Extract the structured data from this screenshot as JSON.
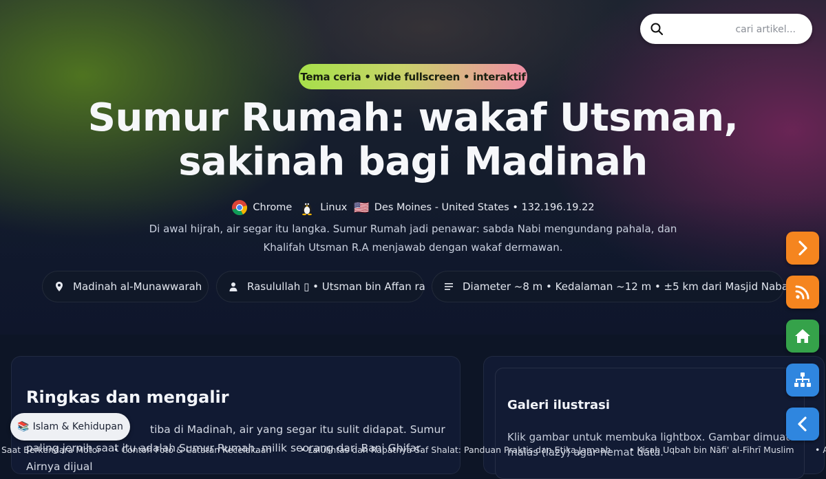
{
  "search": {
    "placeholder": "cari artikel..."
  },
  "hero": {
    "pill": "Tema ceria • wide fullscreen • interaktif",
    "title": "Sumur Rumah: wakaf Utsman, sakinah bagi Madinah",
    "meta": {
      "browser": "Chrome",
      "os": "Linux",
      "location": "Des Moines - United States • 132.196.19.22",
      "flag": "🇺🇸"
    },
    "description": "Di awal hijrah, air segar itu langka. Sumur Rumah jadi penawar: sabda Nabi mengundang pahala, dan Khalifah Utsman R.A menjawab dengan wakaf dermawan.",
    "chips": [
      {
        "icon": "location-pin-icon",
        "label": "Madinah al-Munawwarah"
      },
      {
        "icon": "person-icon",
        "label": "Rasulullah ▯ • Utsman bin Affan ra"
      },
      {
        "icon": "list-icon",
        "label": "Diameter ~8 m • Kedalaman ~12 m • ±5 km dari Masjid Nabawi"
      }
    ]
  },
  "summary": {
    "title": "Ringkas dan mengalir",
    "body_visible": "tiba di Madinah, air yang segar itu sulit didapat. Sumur paling jernih saat itu adalah Sumur Rumah, milik seorang dari Bani Ghifar. Airnya dijual"
  },
  "gallery": {
    "title": "Galeri ilustrasi",
    "body": "Klik gambar untuk membuka lightbox. Gambar dimuat malas (lazy) agar hemat data."
  },
  "category_button": {
    "emoji": "📚",
    "label": "Islam & Kehidupan"
  },
  "ticker": [
    "Saat Berkendara Motor",
    "• Contoh Foto & Catatan Kecelakaan",
    "• Lalulintas dan Rapatnya Saf Shalat: Panduan Praktis dan Etika Jamaah",
    "• Kisah Uqbah bin Nāfi' al-Fihrī Muslim",
    "• A"
  ],
  "fabs": [
    {
      "name": "next-icon",
      "color": "#f5851f"
    },
    {
      "name": "rss-icon",
      "color": "#f5851f"
    },
    {
      "name": "home-icon",
      "color": "#35a24a"
    },
    {
      "name": "sitemap-icon",
      "color": "#2f86df"
    },
    {
      "name": "back-icon",
      "color": "#2f86df"
    }
  ]
}
